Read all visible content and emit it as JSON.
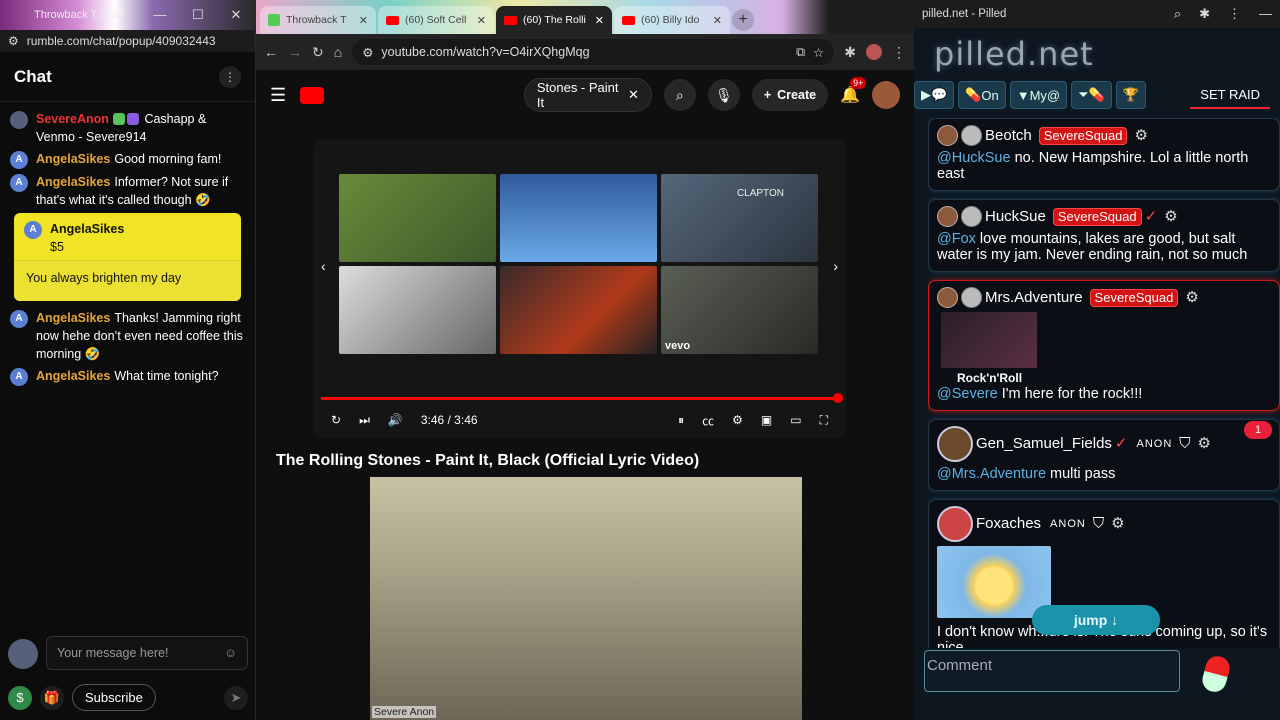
{
  "rumble": {
    "tab_title": "Throwback T...nada...",
    "url": "rumble.com/chat/popup/409032443",
    "header": "Chat",
    "messages": [
      {
        "user": "SevereAnon",
        "text": "Cashapp & Venmo - Severe914",
        "avatar": "S",
        "role": "owner"
      },
      {
        "user": "AngelaSikes",
        "text": "Good morning fam!",
        "avatar": "A"
      },
      {
        "user": "AngelaSikes",
        "text": "Informer? Not sure if that's what it's called though 🤣",
        "avatar": "A"
      }
    ],
    "rant": {
      "user": "AngelaSikes",
      "amount": "$5",
      "text": "You always brighten my day",
      "avatar": "A"
    },
    "messages2": [
      {
        "user": "AngelaSikes",
        "text": "Thanks! Jamming right now hehe don’t even need coffee this morning 🤣",
        "avatar": "A"
      },
      {
        "user": "AngelaSikes",
        "text": "What time tonight?",
        "avatar": "A"
      }
    ],
    "input_placeholder": "Your message here!",
    "subscribe_label": "Subscribe"
  },
  "chrome": {
    "tabs": [
      {
        "label": "Throwback T"
      },
      {
        "label": "(60) Soft Cell"
      },
      {
        "label": "(60) The Rolli"
      },
      {
        "label": "(60) Billy Ido"
      }
    ],
    "url": "youtube.com/watch?v=O4irXQhgMqg"
  },
  "youtube": {
    "search_value": "Stones - Paint It",
    "create_label": "Create",
    "notif_count": "9+",
    "time": "3:46 / 3:46",
    "progress": 1.0,
    "title": "The Rolling Stones - Paint It, Black (Official Lyric Video)",
    "webcam_label": "Severe Anon",
    "vevo": "vevo",
    "clapton": "CLAPTON"
  },
  "pilled": {
    "window_title": "pilled.net - Pilled",
    "logo": "pilled.net",
    "nav": {
      "on": "On",
      "my": "My@"
    },
    "set_raid": "SET RAID",
    "posts": [
      {
        "user": "Beotch",
        "tag": "SevereSquad",
        "mention": "@HuckSue",
        "text": " no. New Hampshire. Lol a little north east"
      },
      {
        "user": "HuckSue",
        "tag": "SevereSquad",
        "mention": "@Fox",
        "text": " love mountains, lakes are good, but salt water is my jam. Never ending rain, not so much"
      },
      {
        "user": "Mrs.Adventure",
        "tag": "SevereSquad",
        "mention": "@Severe",
        "text": " I'm here for the rock!!!",
        "thumb": "Rock'n'Roll"
      },
      {
        "user": "Gen_Samuel_Fields",
        "mention": "@Mrs.Adventure",
        "text": " multi pass",
        "badge": "ANON"
      },
      {
        "user": "Foxaches",
        "badge": "ANON",
        "text": "I don't know wh...ure is. The suns coming up, so it's nice."
      }
    ],
    "notif": "1",
    "jump_label": "jump ↓",
    "comment_placeholder": "Comment"
  }
}
